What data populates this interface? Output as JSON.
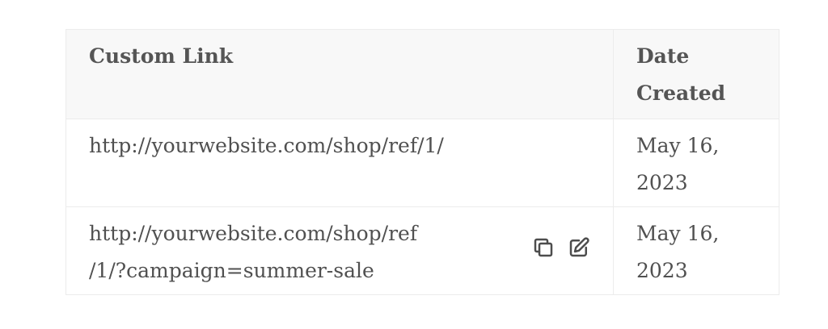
{
  "table": {
    "headers": {
      "link": "Custom Link",
      "date_line1": "Date",
      "date_line2": "Created"
    },
    "rows": [
      {
        "link": "http://yourwebsite.com/shop/ref/1/",
        "date_line1": "May 16,",
        "date_line2": "2023",
        "actions": []
      },
      {
        "link_line1": "http://yourwebsite.com/shop/ref",
        "link_line2": "/1/?campaign=summer-sale",
        "date_line1": "May 16,",
        "date_line2": "2023",
        "actions": [
          "copy-icon",
          "edit-icon"
        ]
      }
    ]
  },
  "colors": {
    "text": "#4d4d4d",
    "header_bg": "#f8f8f8",
    "border": "#ececec"
  }
}
